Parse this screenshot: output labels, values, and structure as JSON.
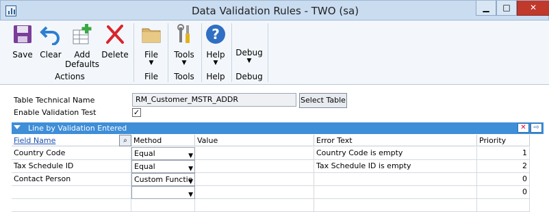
{
  "window": {
    "title": "Data Validation Rules  -  TWO (sa)",
    "controls": {
      "minimize": "▁",
      "maximize": "□",
      "close": "✕"
    }
  },
  "ribbon": {
    "actions_group_label": "Actions",
    "save_label": "Save",
    "clear_label": "Clear",
    "add_defaults_line1": "Add",
    "add_defaults_line2": "Defaults",
    "delete_label": "Delete",
    "file_label": "File",
    "file_group_label": "File",
    "tools_label": "Tools",
    "tools_group_label": "Tools",
    "help_label": "Help",
    "help_group_label": "Help",
    "debug_label": "Debug",
    "debug_group_label": "Debug",
    "dropdown_arrow": "▼"
  },
  "form": {
    "table_name_label": "Table Technical Name",
    "table_name_value": "RM_Customer_MSTR_ADDR",
    "select_table_label": "Select Table",
    "enable_validation_label": "Enable Validation Test",
    "enable_validation_checked": "✓"
  },
  "scrolling_window": {
    "title": "Line by Validation Entered",
    "columns": {
      "field_name": "Field Name",
      "method": "Method",
      "value": "Value",
      "error_text": "Error Text",
      "priority": "Priority"
    },
    "rows": [
      {
        "field_name": "Country Code",
        "method": "Equal",
        "value": "",
        "error_text": "Country Code is empty",
        "priority": "1"
      },
      {
        "field_name": "Tax Schedule ID",
        "method": "Equal",
        "value": "",
        "error_text": "Tax Schedule ID is empty",
        "priority": "2"
      },
      {
        "field_name": "Contact Person",
        "method": "Custom Functio",
        "value": "",
        "error_text": "",
        "priority": "0"
      },
      {
        "field_name": "",
        "method": "",
        "value": "",
        "error_text": "",
        "priority": "0"
      }
    ]
  },
  "colors": {
    "accent_bar": "#3e8ed8",
    "close_button": "#c0392b",
    "ribbon_background": "#f3f7fb"
  }
}
